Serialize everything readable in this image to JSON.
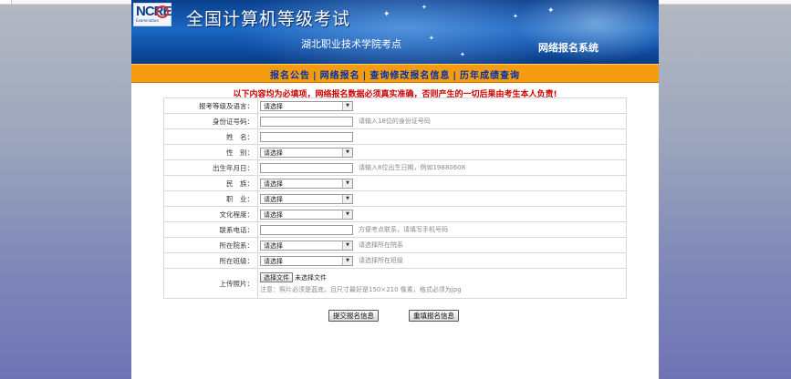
{
  "logo": {
    "text": "NCRE",
    "sub": "Examination",
    "brand_color": "#0c3c8f"
  },
  "banner": {
    "title": "全国计算机等级考试",
    "subtitle": "湖北职业技术学院考点",
    "system": "网络报名系统"
  },
  "nav": {
    "items": [
      "报名公告",
      "网络报名",
      "查询修改报名信息",
      "历年成绩查询"
    ],
    "separator": "|"
  },
  "notice": "以下内容均为必填项，网络报名数据必须真实准确，否则产生的一切后果由考生本人负责!",
  "form": {
    "exam_level": {
      "label": "报考等级及语言：",
      "value": "请选择"
    },
    "id_number": {
      "label": "身份证号码：",
      "value": "",
      "hint": "请输入18位的身份证号码"
    },
    "name": {
      "label": "姓　名：",
      "value": ""
    },
    "gender": {
      "label": "性　别：",
      "value": "请选择"
    },
    "birthdate": {
      "label": "出生年月日：",
      "value": "",
      "hint": "请输入8位出生日期，例如19880608"
    },
    "ethnicity": {
      "label": "民　族：",
      "value": "请选择"
    },
    "occupation": {
      "label": "职　业：",
      "value": "请选择"
    },
    "education": {
      "label": "文化程度：",
      "value": "请选择"
    },
    "phone": {
      "label": "联系电话：",
      "value": "",
      "hint": "方便考点联系，请填写手机号码"
    },
    "department": {
      "label": "所在院系：",
      "value": "请选择",
      "hint": "请选择所在院系"
    },
    "class": {
      "label": "所在班级：",
      "value": "请选择",
      "hint": "请选择所在班级"
    },
    "photo": {
      "label": "上传照片：",
      "button": "选择文件",
      "status": "未选择文件",
      "note": "注意：照片必须是蓝底，且尺寸最好是150×210 像素，格式必须为jpg"
    }
  },
  "actions": {
    "submit": "提交报名信息",
    "reset": "重填报名信息"
  },
  "colors": {
    "nav_bg": "#f59b10",
    "nav_text": "#0033aa",
    "notice": "#cc0000",
    "banner": "#1b67c2"
  }
}
